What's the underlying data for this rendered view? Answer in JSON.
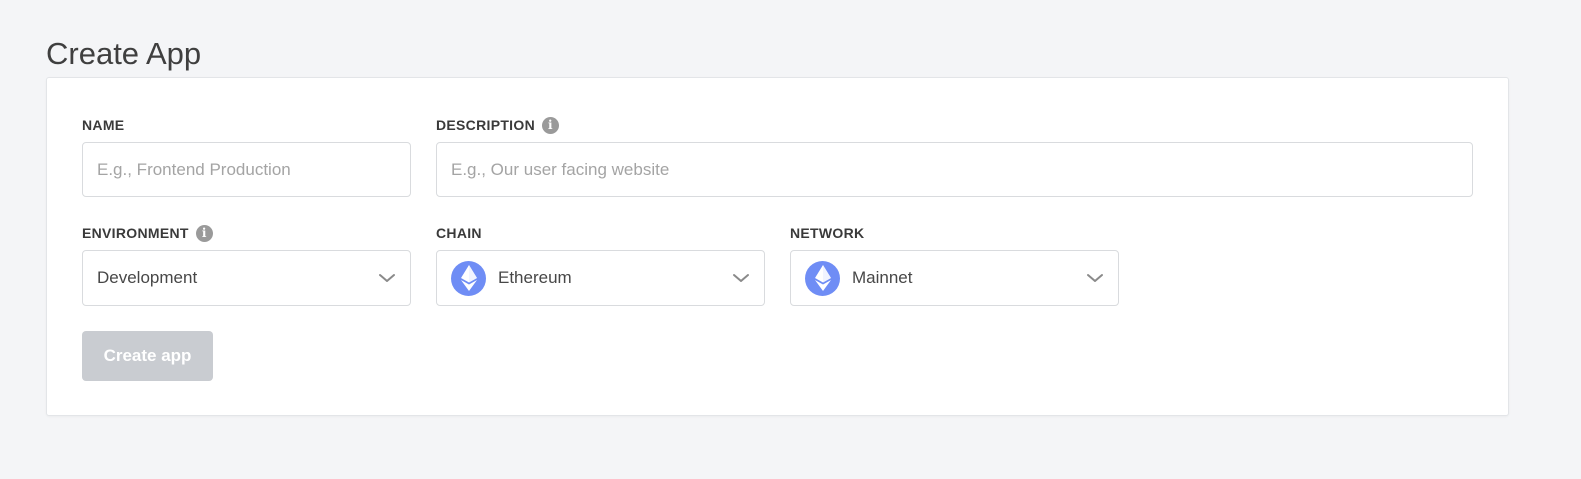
{
  "page": {
    "title": "Create App"
  },
  "form": {
    "name": {
      "label": "NAME",
      "value": "",
      "placeholder": "E.g., Frontend Production"
    },
    "description": {
      "label": "DESCRIPTION",
      "value": "",
      "placeholder": "E.g., Our user facing website",
      "icon": "info-icon"
    },
    "environment": {
      "label": "ENVIRONMENT",
      "value": "Development",
      "icon": "info-icon"
    },
    "chain": {
      "label": "CHAIN",
      "value": "Ethereum",
      "icon": "ethereum-icon"
    },
    "network": {
      "label": "NETWORK",
      "value": "Mainnet",
      "icon": "ethereum-icon"
    },
    "submit": {
      "label": "Create app",
      "disabled": true
    }
  },
  "colors": {
    "background": "#f4f5f7",
    "card": "#ffffff",
    "ethereum_icon": "#6f8df5",
    "disabled_button": "#c9ccd1"
  }
}
